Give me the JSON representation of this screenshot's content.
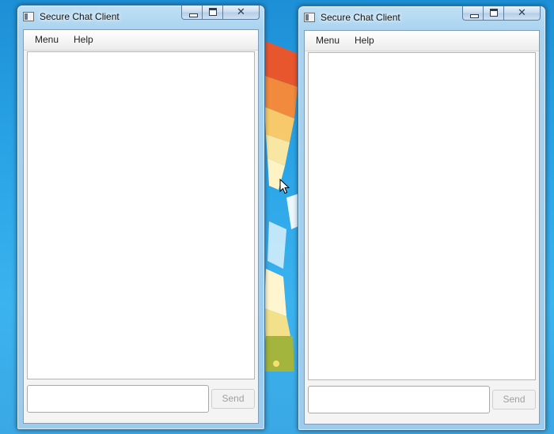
{
  "windows": [
    {
      "title": "Secure Chat Client",
      "menu": [
        "Menu",
        "Help"
      ],
      "chat_text": "",
      "message_input": {
        "value": "",
        "placeholder": ""
      },
      "send_label": "Send"
    },
    {
      "title": "Secure Chat Client",
      "menu": [
        "Menu",
        "Help"
      ],
      "chat_text": "",
      "message_input": {
        "value": "",
        "placeholder": ""
      },
      "send_label": "Send"
    }
  ],
  "title_controls": {
    "close_glyph": "✕"
  },
  "colors": {
    "desktop": "#2aa3e6",
    "window_frame": "#a9d3ef",
    "send_disabled_text": "#a0a0a0"
  }
}
